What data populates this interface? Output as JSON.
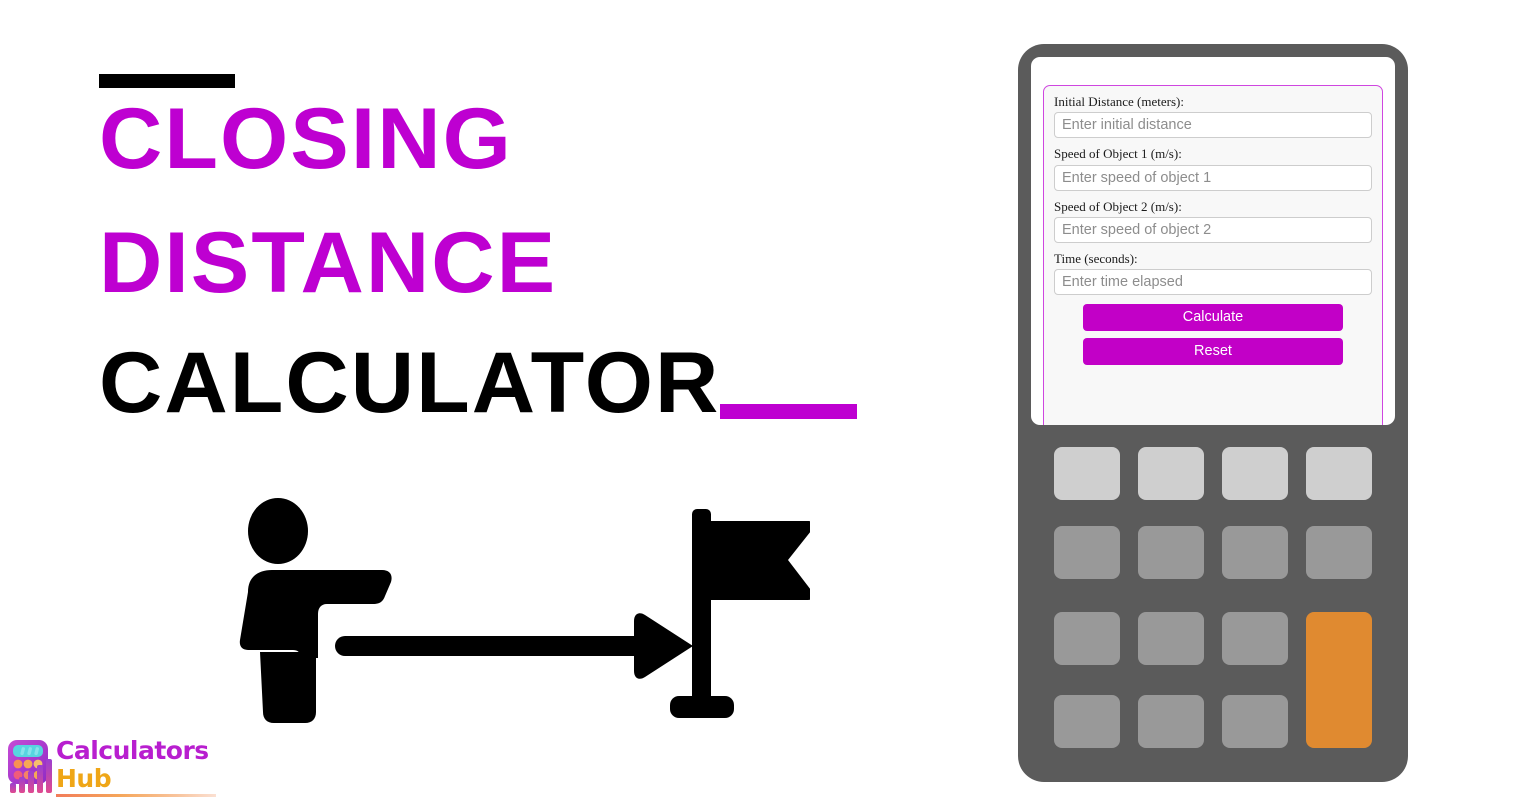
{
  "hero": {
    "title_lines": [
      {
        "text": "Closing",
        "color": "#BE00D1"
      },
      {
        "text": "Distance",
        "color": "#BE00D1"
      },
      {
        "text": "Calculator",
        "color": "#000000"
      }
    ],
    "accent_color": "#BE00D1",
    "rule_top_color": "#000000",
    "illustration": {
      "person_icon": "person-pointing-icon",
      "arrow_icon": "right-arrow-icon",
      "flag_icon": "flag-icon",
      "color": "#000000"
    }
  },
  "logo": {
    "word_primary": "Calculators",
    "word_secondary": "Hub",
    "primary_color": "#B81ECF",
    "secondary_color": "#EFA617",
    "mark_icon": "calculator-bars-logo-icon"
  },
  "device": {
    "body_color": "#5b5b5b",
    "screen_color": "#ffffff",
    "form": {
      "border_color": "#cf46e0",
      "fields": [
        {
          "label": "Initial Distance (meters):",
          "placeholder": "Enter initial distance",
          "value": ""
        },
        {
          "label": "Speed of Object 1 (m/s):",
          "placeholder": "Enter speed of object 1",
          "value": ""
        },
        {
          "label": "Speed of Object 2 (m/s):",
          "placeholder": "Enter speed of object 2",
          "value": ""
        },
        {
          "label": "Time (seconds):",
          "placeholder": "Enter time elapsed",
          "value": ""
        }
      ],
      "buttons": [
        {
          "label": "Calculate",
          "color": "#C200C7"
        },
        {
          "label": "Reset",
          "color": "#C200C7"
        }
      ]
    },
    "keypad": {
      "rows": 4,
      "cols": 4,
      "top_row_color": "#cfcfcf",
      "key_color": "#999999",
      "accent_key_color": "#E08A30",
      "accent_key_span_rows": 2
    }
  }
}
